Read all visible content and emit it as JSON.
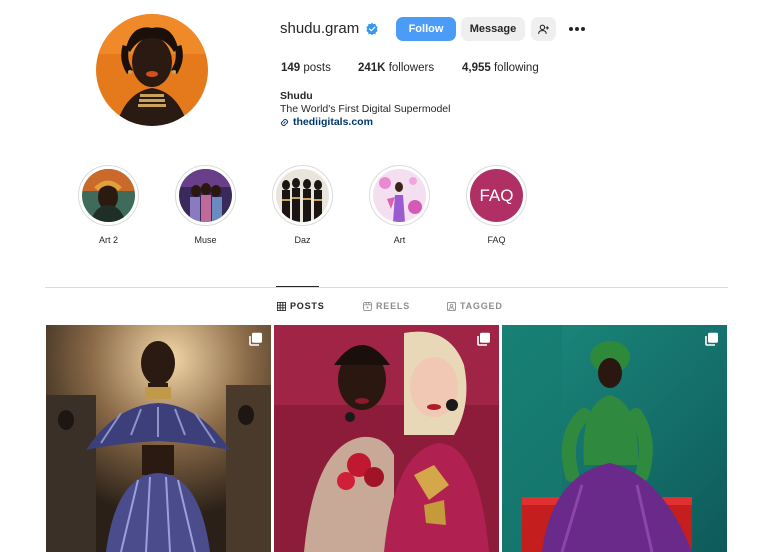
{
  "profile": {
    "username": "shudu.gram",
    "verified": true,
    "follow_label": "Follow",
    "message_label": "Message",
    "add_user_icon": "person-plus-icon",
    "more_icon": "more-horizontal-icon"
  },
  "stats": {
    "posts_count": "149",
    "posts_label": " posts",
    "followers_count": "241K",
    "followers_label": " followers",
    "following_count": "4,955",
    "following_label": " following"
  },
  "bio": {
    "name": "Shudu",
    "tagline": "The World's First Digital Supermodel",
    "link": "thediigitals.com",
    "link_icon": "link-icon"
  },
  "highlights": [
    {
      "label": "Art 2"
    },
    {
      "label": "Muse"
    },
    {
      "label": "Daz"
    },
    {
      "label": "Art"
    },
    {
      "label": "FAQ",
      "cover_text": "FAQ"
    }
  ],
  "tabs": [
    {
      "label": "POSTS",
      "icon": "grid-icon",
      "active": true
    },
    {
      "label": "REELS",
      "icon": "reels-icon",
      "active": false
    },
    {
      "label": "TAGGED",
      "icon": "tagged-icon",
      "active": false
    }
  ],
  "posts": [
    {
      "icon": "multiple-photos-icon"
    },
    {
      "icon": "multiple-photos-icon"
    },
    {
      "icon": "multiple-photos-icon"
    }
  ],
  "colors": {
    "follow_blue": "#4a9cf6",
    "verified_blue": "#3897f0",
    "link_blue": "#00376b",
    "faq_magenta": "#b03065"
  }
}
